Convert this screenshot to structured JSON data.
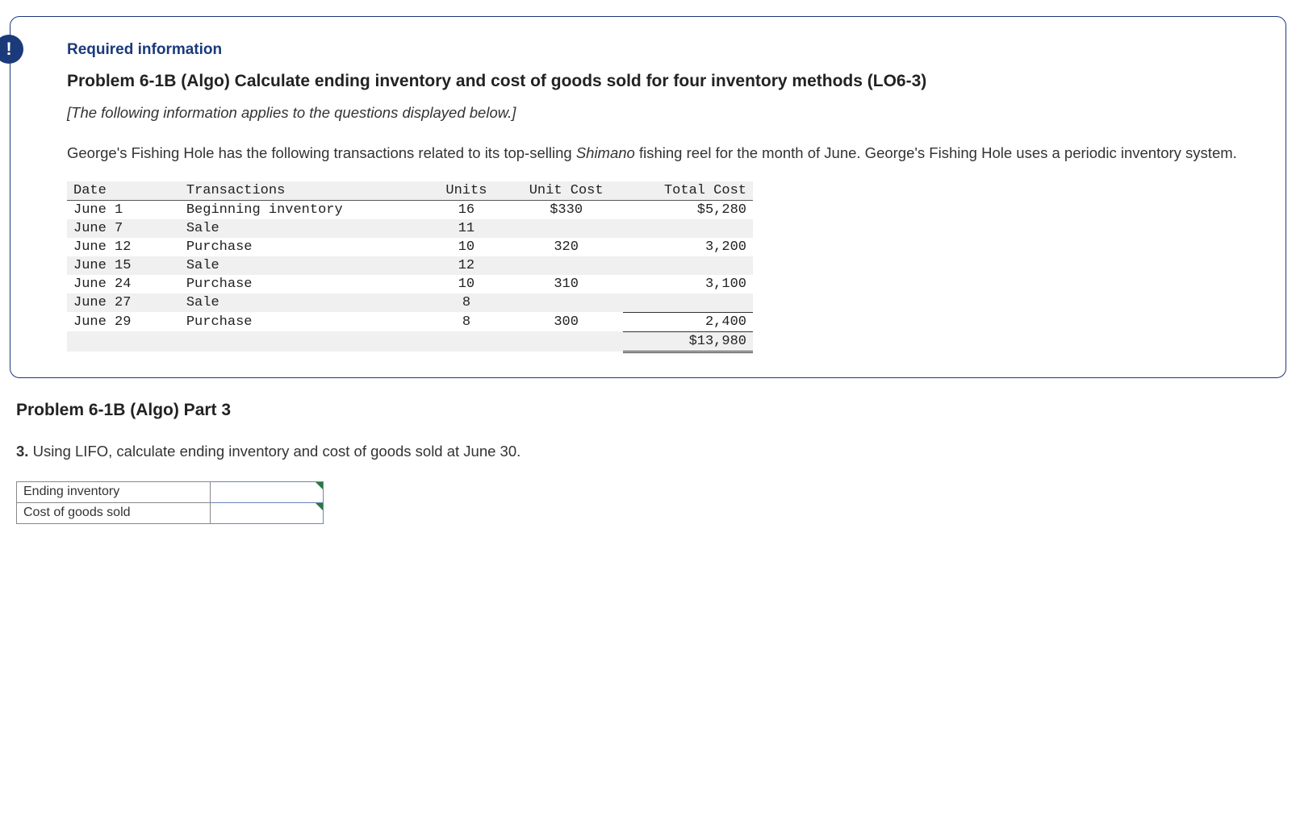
{
  "badge_symbol": "!",
  "required_label": "Required information",
  "problem_title": "Problem 6-1B (Algo) Calculate ending inventory and cost of goods sold for four inventory methods (LO6-3)",
  "applies_note": "[The following information applies to the questions displayed below.]",
  "body_para_pre": "George's Fishing Hole has the following transactions related to its top-selling ",
  "body_para_em": "Shimano",
  "body_para_post": " fishing reel for the month of June. George's Fishing Hole uses a periodic inventory system.",
  "table": {
    "headers": {
      "date": "Date",
      "tx": "Transactions",
      "units": "Units",
      "unit_cost": "Unit Cost",
      "total_cost": "Total Cost"
    },
    "rows": [
      {
        "date": "June 1",
        "tx": "Beginning inventory",
        "units": "16",
        "unit_cost": "$330",
        "total_cost": "$5,280"
      },
      {
        "date": "June 7",
        "tx": "Sale",
        "units": "11",
        "unit_cost": "",
        "total_cost": ""
      },
      {
        "date": "June 12",
        "tx": "Purchase",
        "units": "10",
        "unit_cost": "320",
        "total_cost": "3,200"
      },
      {
        "date": "June 15",
        "tx": "Sale",
        "units": "12",
        "unit_cost": "",
        "total_cost": ""
      },
      {
        "date": "June 24",
        "tx": "Purchase",
        "units": "10",
        "unit_cost": "310",
        "total_cost": "3,100"
      },
      {
        "date": "June 27",
        "tx": "Sale",
        "units": "8",
        "unit_cost": "",
        "total_cost": ""
      },
      {
        "date": "June 29",
        "tx": "Purchase",
        "units": "8",
        "unit_cost": "300",
        "total_cost": "2,400"
      }
    ],
    "grand_total": "$13,980"
  },
  "part_title": "Problem 6-1B (Algo) Part 3",
  "question_num": "3.",
  "question_text": " Using LIFO, calculate ending inventory and cost of goods sold at June 30.",
  "answer": {
    "row1_label": "Ending inventory",
    "row2_label": "Cost of goods sold",
    "row1_value": "",
    "row2_value": ""
  }
}
